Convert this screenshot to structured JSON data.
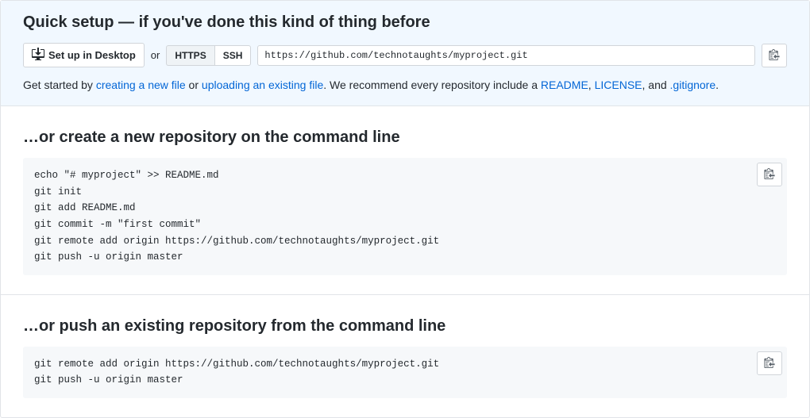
{
  "quick_setup": {
    "title": "Quick setup — if you've done this kind of thing before",
    "desktop_button": "Set up in Desktop",
    "or_text": "or",
    "https_label": "HTTPS",
    "ssh_label": "SSH",
    "clone_url": "https://github.com/technotaughts/myproject.git",
    "hint_prefix": "Get started by ",
    "link_create": "creating a new file",
    "hint_or": " or ",
    "link_upload": "uploading an existing file",
    "hint_mid": ". We recommend every repository include a ",
    "link_readme": "README",
    "comma": ", ",
    "link_license": "LICENSE",
    "and": ", and ",
    "link_gitignore": ".gitignore",
    "period": "."
  },
  "section_create": {
    "title": "…or create a new repository on the command line",
    "code": "echo \"# myproject\" >> README.md\ngit init\ngit add README.md\ngit commit -m \"first commit\"\ngit remote add origin https://github.com/technotaughts/myproject.git\ngit push -u origin master"
  },
  "section_push": {
    "title": "…or push an existing repository from the command line",
    "code": "git remote add origin https://github.com/technotaughts/myproject.git\ngit push -u origin master"
  }
}
